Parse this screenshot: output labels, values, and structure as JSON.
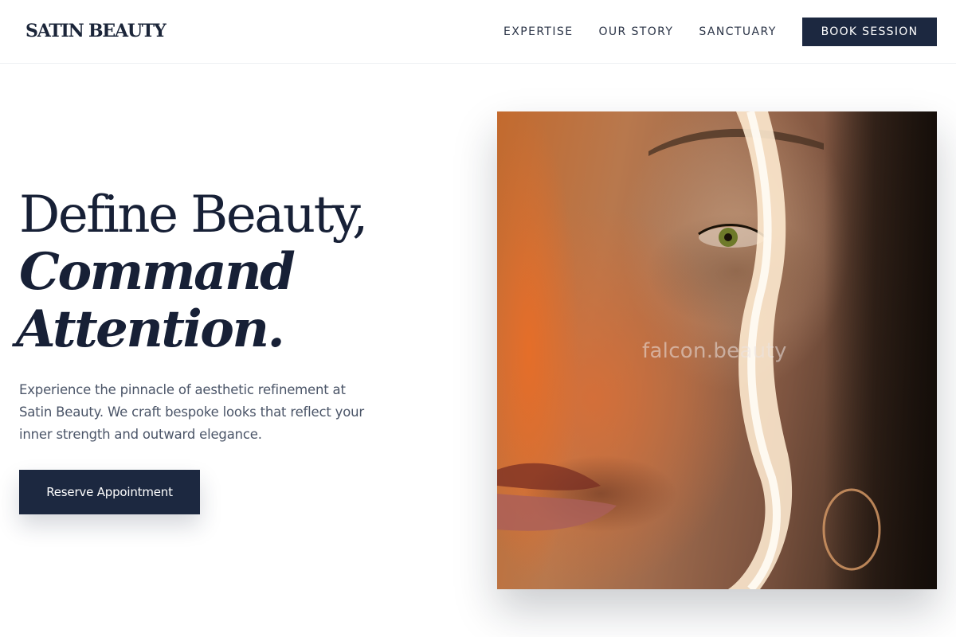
{
  "header": {
    "logo": "SATIN BEAUTY",
    "nav": [
      "EXPERTISE",
      "OUR STORY",
      "SANCTUARY"
    ],
    "cta": "BOOK SESSION"
  },
  "hero": {
    "title_line1": "Define Beauty,",
    "title_line2": "Command",
    "title_line3": "Attention.",
    "description": "Experience the pinnacle of aesthetic refinement at Satin Beauty. We craft bespoke looks that reflect your inner strength and outward elegance.",
    "button": "Reserve Appointment",
    "image_watermark": "falcon.beauty"
  },
  "colors": {
    "navy": "#1c2840",
    "text_body": "#4b5568",
    "background": "#ffffff"
  }
}
